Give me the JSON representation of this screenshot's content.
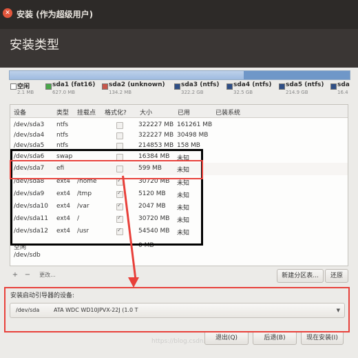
{
  "window": {
    "title": "安装 (作为超级用户)",
    "page_title": "安装类型"
  },
  "colors": {
    "free": "#a8c4e6",
    "fat16": "#4aa84a",
    "unknown": "#c7574c",
    "ntfs": "#2f4f86",
    "ntfs2": "#2f4f86",
    "ntfs3": "#2f4f86"
  },
  "legend": [
    {
      "name": "空闲",
      "size": "2.1 MB",
      "color": "#ffffff"
    },
    {
      "name": "sda1 (fat16)",
      "size": "627.0 MB",
      "color": "#4aa84a"
    },
    {
      "name": "sda2 (unknown)",
      "size": "134.2 MB",
      "color": "#c7574c"
    },
    {
      "name": "sda3 (ntfs)",
      "size": "322.2 GB",
      "color": "#2f4f86"
    },
    {
      "name": "sda4 (ntfs)",
      "size": "32.5 GB",
      "color": "#2f4f86"
    },
    {
      "name": "sda5 (ntfs)",
      "size": "214.9 GB",
      "color": "#2f4f86"
    },
    {
      "name": "sda",
      "size": "16.4",
      "color": "#2f4f86"
    }
  ],
  "table": {
    "headers": {
      "device": "设备",
      "type": "类型",
      "mount": "挂载点",
      "format": "格式化?",
      "size": "大小",
      "used": "已用",
      "system": "已装系统"
    },
    "rows": [
      {
        "device": "/dev/sda3",
        "type": "ntfs",
        "mount": "",
        "format": false,
        "size": "322227 MB",
        "used": "161261 MB"
      },
      {
        "device": "/dev/sda4",
        "type": "ntfs",
        "mount": "",
        "format": false,
        "size": "322227 MB",
        "used": "30498 MB"
      },
      {
        "device": "/dev/sda5",
        "type": "ntfs",
        "mount": "",
        "format": false,
        "size": "214853 MB",
        "used": "158 MB"
      },
      {
        "device": "/dev/sda6",
        "type": "swap",
        "mount": "",
        "format": false,
        "size": "16384 MB",
        "used": "未知"
      },
      {
        "device": "/dev/sda7",
        "type": "efi",
        "mount": "",
        "format": false,
        "size": "599 MB",
        "used": "未知"
      },
      {
        "device": "/dev/sda8",
        "type": "ext4",
        "mount": "/home",
        "format": true,
        "size": "30720 MB",
        "used": "未知"
      },
      {
        "device": "/dev/sda9",
        "type": "ext4",
        "mount": "/tmp",
        "format": true,
        "size": "5120 MB",
        "used": "未知"
      },
      {
        "device": "/dev/sda10",
        "type": "ext4",
        "mount": "/var",
        "format": true,
        "size": "2047 MB",
        "used": "未知"
      },
      {
        "device": "/dev/sda11",
        "type": "ext4",
        "mount": "/",
        "format": true,
        "size": "30720 MB",
        "used": "未知"
      },
      {
        "device": "/dev/sda12",
        "type": "ext4",
        "mount": "/usr",
        "format": true,
        "size": "54540 MB",
        "used": "未知"
      },
      {
        "device": "空闲",
        "type": "",
        "mount": "",
        "format": false,
        "size": "0 MB",
        "used": ""
      },
      {
        "device": "/dev/sdb",
        "type": "",
        "mount": "",
        "format": false,
        "size": "",
        "used": ""
      }
    ]
  },
  "toolbar": {
    "add": "+",
    "remove": "−",
    "change": "更改...",
    "new_table": "新建分区表...",
    "revert": "还原"
  },
  "boot": {
    "label": "安装启动引导器的设备:",
    "device": "/dev/sda",
    "model": "ATA WDC WD10JPVX-22J (1.0 T"
  },
  "actions": {
    "quit": "退出(Q)",
    "back": "后退(B)",
    "install": "现在安装(I)"
  },
  "watermark": "https://blog.csdn.net/..."
}
